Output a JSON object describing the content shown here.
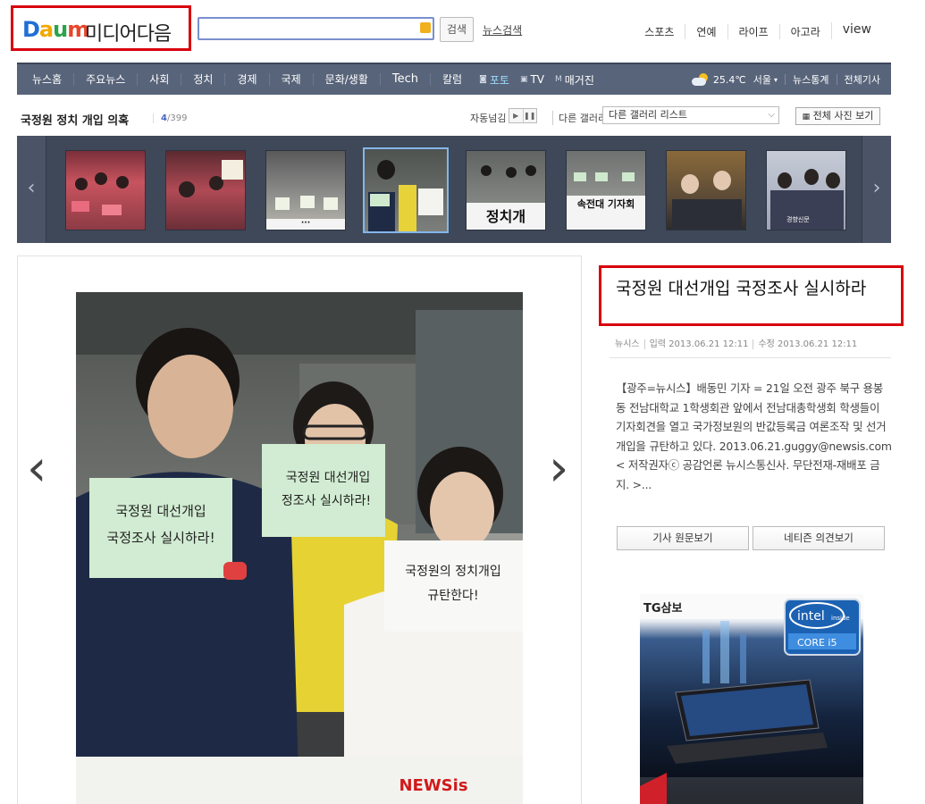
{
  "header": {
    "logo_daum": "Daum",
    "logo_text": "미디어다음",
    "search_placeholder": "",
    "search_button": "검색",
    "news_search_link": "뉴스검색",
    "top_links": [
      "스포츠",
      "연예",
      "라이프",
      "아고라",
      "view"
    ]
  },
  "nav": {
    "items": [
      "뉴스홈",
      "주요뉴스",
      "사회",
      "정치",
      "경제",
      "국제",
      "문화/생활",
      "Tech",
      "칼럼"
    ],
    "media": [
      {
        "label": "포토",
        "active": true
      },
      {
        "label": "TV",
        "active": false
      },
      {
        "label": "매거진",
        "active": false
      }
    ],
    "weather": {
      "temp": "25.4℃",
      "city": "서울"
    },
    "right_links": [
      "뉴스통계",
      "전체기사"
    ]
  },
  "gallery": {
    "title": "국정원 정치 개입 의혹",
    "current": "4",
    "total": "/399",
    "autoplay_label": "자동넘김",
    "other_gallery_label": "다른 갤러리",
    "select_value": "다른 갤러리 리스트",
    "view_all": "전체 사진 보기"
  },
  "thumbnails": {
    "banner_text": [
      "정치개",
      "정치개입",
      "속전대 기자회"
    ],
    "watermark": "경향신문"
  },
  "photo": {
    "sign1_line1": "국정원 대선개입",
    "sign1_line2": "국정조사 실시하라!",
    "sign2_line1": "국정원 대선개입",
    "sign2_line2": "정조사 실시하라!",
    "sign3_line1": "국정원의 정치개입",
    "sign3_line2": "규탄한다!",
    "watermark": "NEWSis"
  },
  "article": {
    "headline": "국정원 대선개입 국정조사 실시하라",
    "source": "뉴시스",
    "input_time": "입력 2013.06.21 12:11",
    "edit_time": "수정 2013.06.21 12:11",
    "summary": "【광주=뉴시스】배동민 기자 = 21일 오전 광주 북구 용봉동 전남대학교 1학생회관 앞에서 전남대총학생회 학생들이 기자회견을 열고 국가정보원의 반값등록금 여론조작 및 선거개입을 규탄하고 있다. 2013.06.21.guggy@newsis.com< 저작권자ⓒ 공감언론 뉴시스통신사. 무단전재-재배포 금지. >...",
    "btn_original": "기사 원문보기",
    "btn_comments": "네티즌 의견보기"
  },
  "ad": {
    "brand": "TG삼보",
    "chip": "intel",
    "chip_sub": "inside",
    "chip_model": "CORE i5"
  },
  "colors": {
    "highlight_red": "#d8000c",
    "nav_bg": "#58647a",
    "strip_bg": "#3f4858",
    "accent_blue": "#4765c7"
  }
}
